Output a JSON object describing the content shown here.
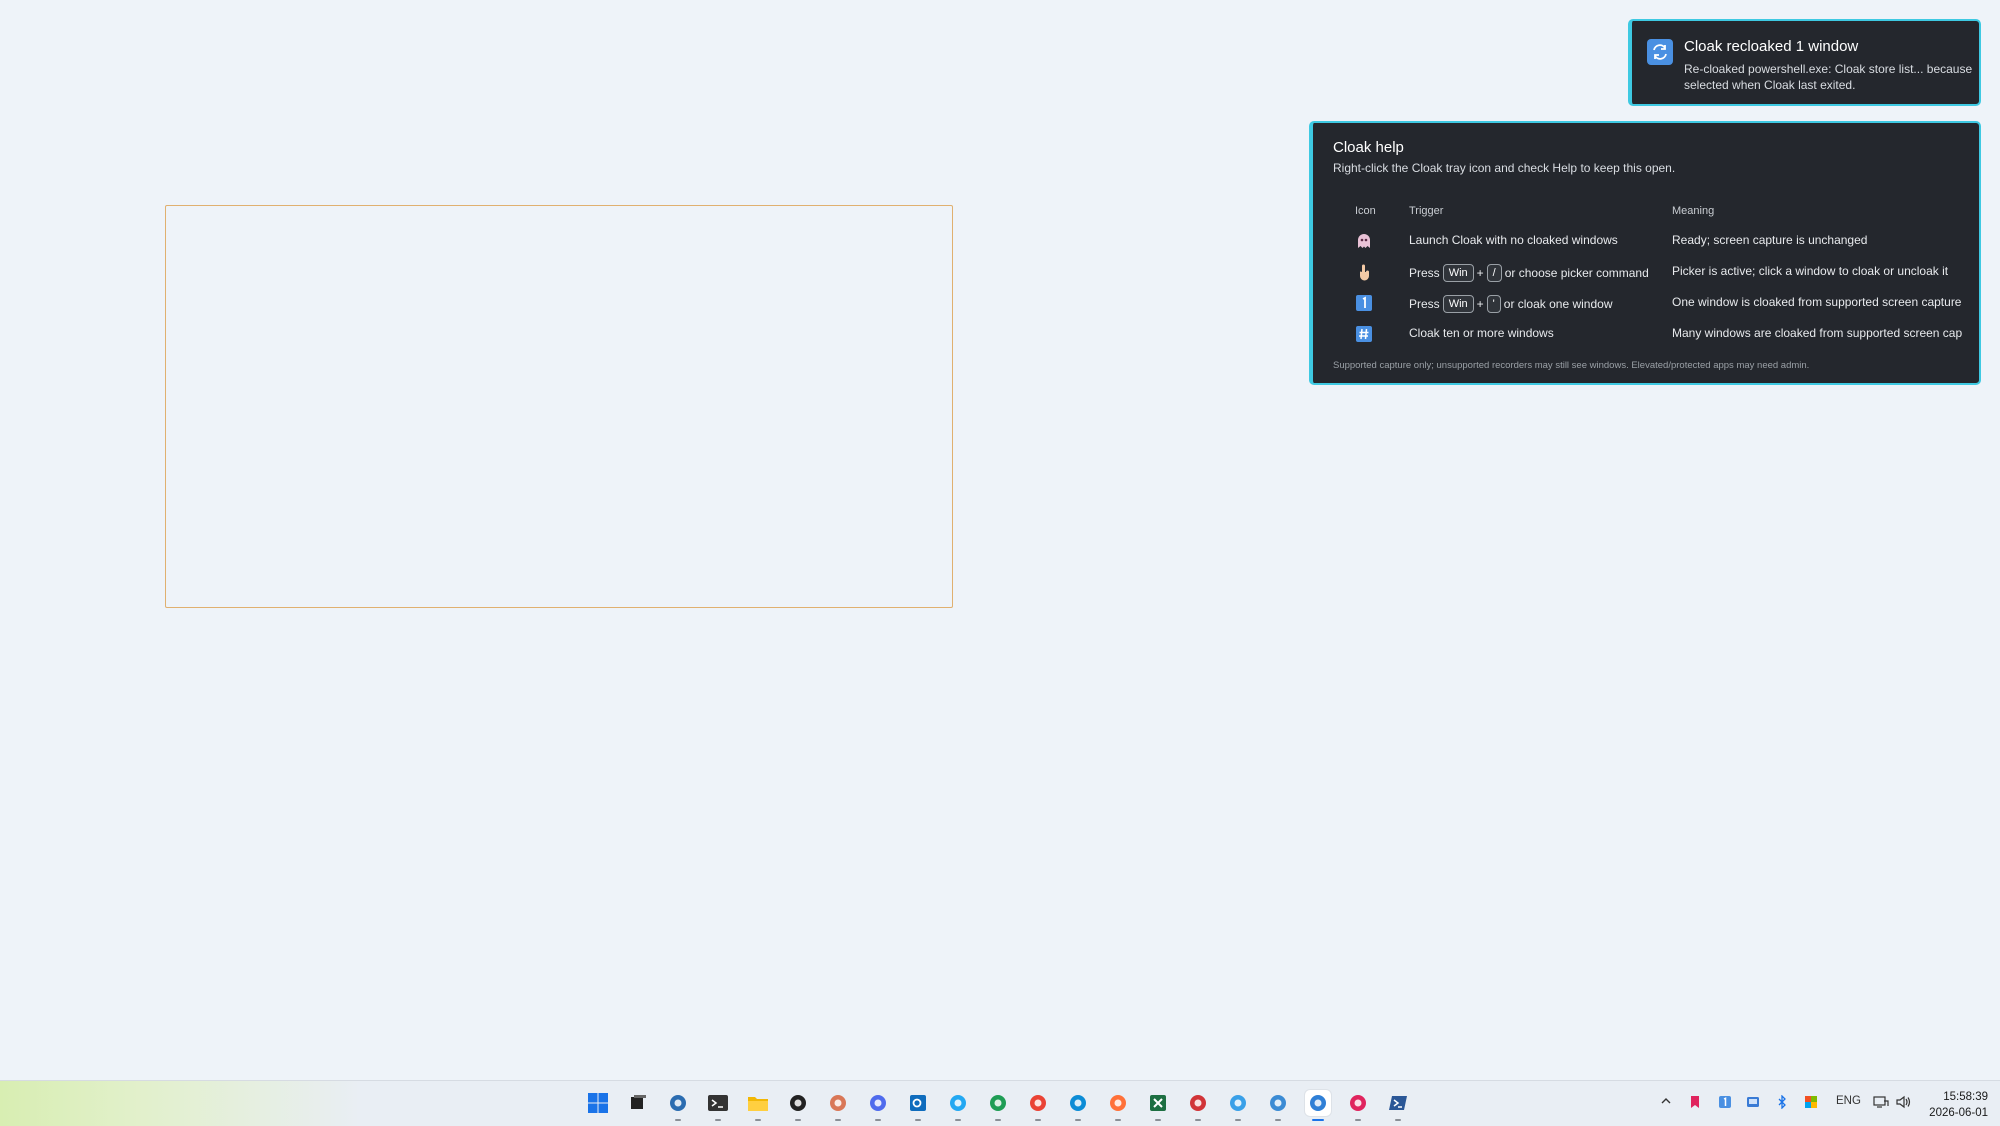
{
  "toast": {
    "icon": "refresh-icon",
    "title": "Cloak recloaked 1 window",
    "body": "Re-cloaked powershell.exe: Cloak store list... because selected when Cloak last exited."
  },
  "help": {
    "title": "Cloak help",
    "subtitle": "Right-click the Cloak tray icon and check Help to keep this open.",
    "columns": {
      "icon": "Icon",
      "trigger": "Trigger",
      "meaning": "Meaning"
    },
    "rows": [
      {
        "icon": "ghost-icon",
        "trigger_text": "Launch Cloak with no cloaked windows",
        "meaning": "Ready; screen capture is unchanged"
      },
      {
        "icon": "pointer-hand-icon",
        "trigger_prefix": "Press",
        "key1": "Win",
        "plus": "+",
        "key2": "/",
        "trigger_suffix": "or choose picker command",
        "meaning": "Picker is active; click a window to cloak or uncloak it"
      },
      {
        "icon": "number-one-icon",
        "trigger_prefix": "Press",
        "key1": "Win",
        "plus": "+",
        "key2": "'",
        "trigger_suffix": "or cloak one window",
        "meaning": "One window is cloaked from supported screen capture"
      },
      {
        "icon": "hash-icon",
        "trigger_text": "Cloak ten or more windows",
        "meaning": "Many windows are cloaked from supported screen cap"
      }
    ],
    "footnote": "Supported capture only; unsupported recorders may still see windows. Elevated/protected apps may need admin."
  },
  "taskbar": {
    "apps": [
      {
        "name": "start-icon",
        "color": "#1a73e8"
      },
      {
        "name": "task-view-icon",
        "color": "#222222"
      },
      {
        "name": "widgets-icon",
        "color": "#2b6cb0"
      },
      {
        "name": "terminal-icon",
        "color": "#333333"
      },
      {
        "name": "file-explorer-icon",
        "color": "#f2b705"
      },
      {
        "name": "chatgpt-icon",
        "color": "#222222"
      },
      {
        "name": "claude-icon",
        "color": "#d97757"
      },
      {
        "name": "app-blue-icon",
        "color": "#4f6bed"
      },
      {
        "name": "outlook-icon",
        "color": "#0f6cbd"
      },
      {
        "name": "vscode-icon",
        "color": "#23a8f2"
      },
      {
        "name": "edge-dev-icon",
        "color": "#1f9d55"
      },
      {
        "name": "chrome-icon",
        "color": "#ea4335"
      },
      {
        "name": "edge-icon",
        "color": "#0c8cd6"
      },
      {
        "name": "firefox-icon",
        "color": "#ff7139"
      },
      {
        "name": "excel-icon",
        "color": "#1d6f42"
      },
      {
        "name": "snipping-tool-icon",
        "color": "#d13438"
      },
      {
        "name": "remote-desktop-icon",
        "color": "#3aa0e8"
      },
      {
        "name": "globe-app-icon",
        "color": "#3b8bd4"
      },
      {
        "name": "paint-icon",
        "color": "#2f7fd6"
      },
      {
        "name": "bookmark-app-icon",
        "color": "#e0245e"
      },
      {
        "name": "powershell-icon",
        "color": "#2b5797"
      }
    ],
    "tray": {
      "language": "ENG",
      "time": "15:58:39",
      "date": "2026-06-01"
    }
  }
}
